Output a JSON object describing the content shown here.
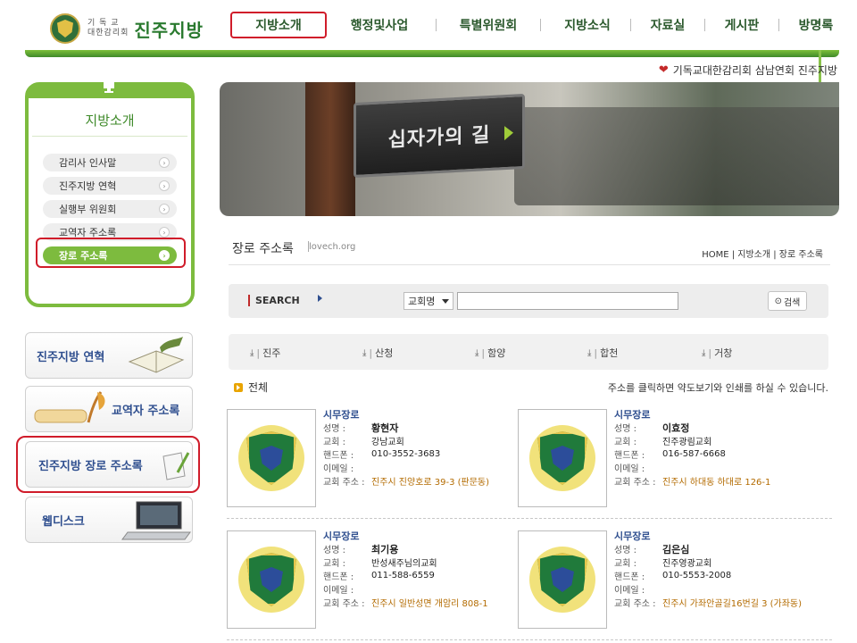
{
  "header": {
    "logo_small_1": "기 독 교",
    "logo_small_2": "대한감리회",
    "logo_big": "진주지방",
    "nav": [
      "지방소개",
      "행정및사업",
      "특별위원회",
      "지방소식",
      "자료실",
      "게시판",
      "방명록"
    ],
    "tagline": "기독교대한감리회 삼남연회 진주지방"
  },
  "lnb": {
    "title": "지방소개",
    "items": [
      "감리사 인사말",
      "진주지방 연혁",
      "실행부 위원회",
      "교역자 주소록",
      "장로 주소록"
    ],
    "active_index": 4
  },
  "banners": [
    "진주지방 연혁",
    "교역자 주소록",
    "진주지방 장로 주소록",
    "웹디스크"
  ],
  "hero": {
    "sign_text": "십자가의 길"
  },
  "page": {
    "title": "장로 주소록",
    "domain": "lovech.org",
    "breadcrumb": "HOME | 지방소개 | 장로 주소록"
  },
  "search": {
    "label": "SEARCH",
    "select_value": "교회명",
    "input_value": "",
    "button_label": "검색"
  },
  "regions": [
    "진주",
    "산청",
    "함양",
    "합천",
    "거창"
  ],
  "list": {
    "head": "전체",
    "note": "주소를 클릭하면 약도보기와 인쇄를 하실 수 있습니다.",
    "labels": {
      "name": "성명 :",
      "church": "교회 :",
      "phone": "핸드폰 :",
      "email": "이메일 :",
      "address": "교회 주소 :"
    },
    "cards": [
      {
        "role": "시무장로",
        "name": "황현자",
        "church": "강남교회",
        "phone": "010-3552-3683",
        "email": "",
        "address": "진주시 진양호로 39-3 (판문동)"
      },
      {
        "role": "시무장로",
        "name": "이효정",
        "church": "진주광림교회",
        "phone": "016-587-6668",
        "email": "",
        "address": "진주시 하대동 하대로 126-1"
      },
      {
        "role": "시무장로",
        "name": "최기용",
        "church": "반성새주님의교회",
        "phone": "011-588-6559",
        "email": "",
        "address": "진주시 일반성면 개암리 808-1"
      },
      {
        "role": "시무장로",
        "name": "김은심",
        "church": "진주영광교회",
        "phone": "010-5553-2008",
        "email": "",
        "address": "진주시 가좌안골길16번길 3 (가좌동)"
      }
    ]
  },
  "colors": {
    "accent_green": "#7dbb3e",
    "highlight_red": "#d01c2a",
    "link_blue": "#2f4f8f",
    "address_orange": "#b36b00"
  }
}
